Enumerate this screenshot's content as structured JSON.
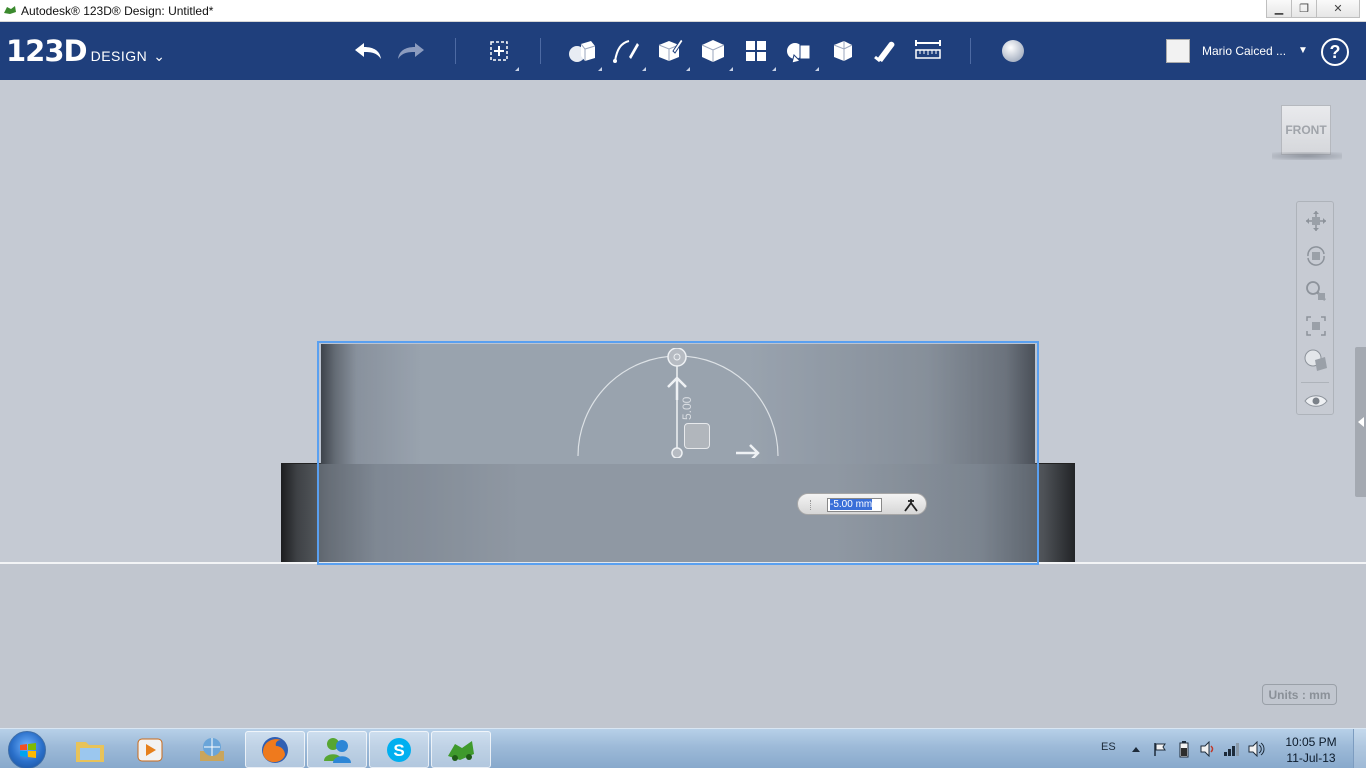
{
  "window": {
    "title": "Autodesk® 123D® Design: Untitled*",
    "minimize_icon": "minimize-icon",
    "restore_icon": "restore-icon",
    "close_icon": "close-icon"
  },
  "toolbar": {
    "brand_big": "123D",
    "brand_small": "DESIGN",
    "brand_chevron": "⌄",
    "tools": [
      "undo",
      "redo",
      "transform",
      "primitives",
      "sketch",
      "construct",
      "modify",
      "pattern",
      "grouping",
      "combine",
      "snap",
      "measure",
      "material"
    ],
    "user_name": "Mario Caiced ...",
    "user_dropdown": "▼",
    "help_label": "?",
    "bg_color": "#1f3f7c"
  },
  "viewport": {
    "dimension_label": "5.00",
    "input_value": "-5.00 mm",
    "viewcube_label": "FRONT",
    "units_label": "Units : mm",
    "nav_buttons": [
      "pan",
      "orbit",
      "zoom",
      "fit",
      "view-style",
      "visibility"
    ],
    "selection_color": "#5aa0f0"
  },
  "taskbar": {
    "apps": [
      "explorer",
      "media-player",
      "app",
      "firefox",
      "messenger",
      "skype",
      "123d-design"
    ],
    "language": "ES",
    "time": "10:05 PM",
    "date": "11-Jul-13"
  }
}
